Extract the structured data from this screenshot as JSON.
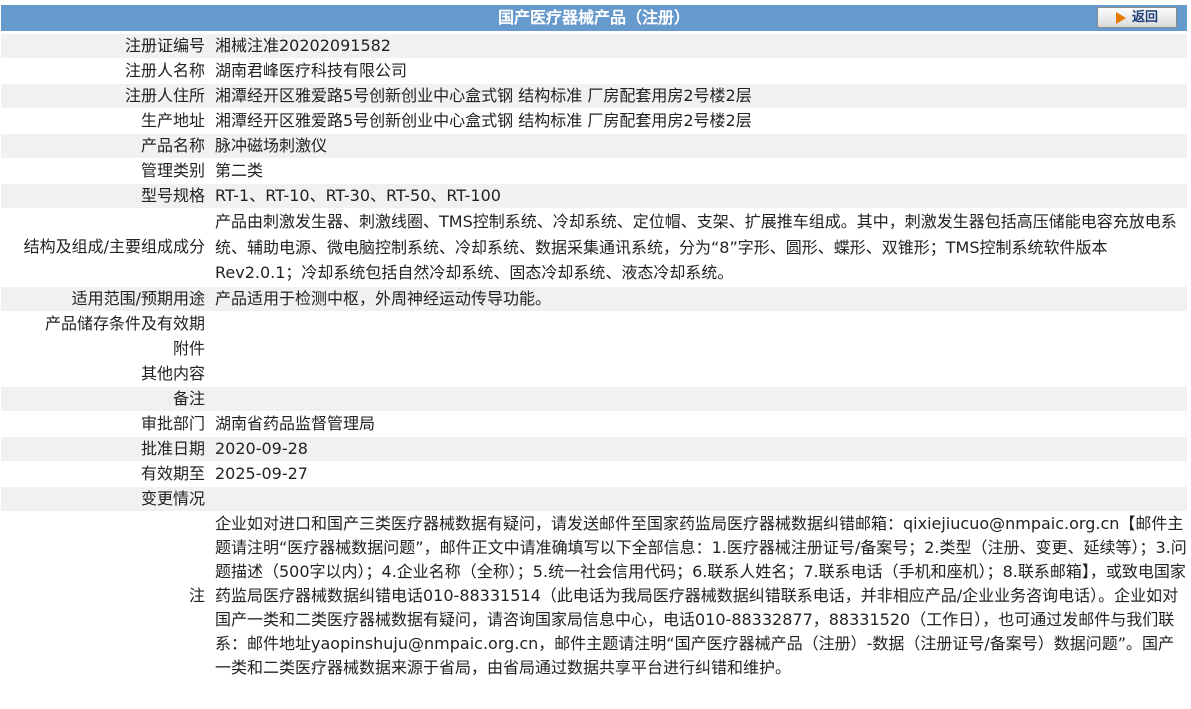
{
  "header": {
    "title": "国产医疗器械产品（注册）",
    "back_label": "返回"
  },
  "rows": [
    {
      "label": "注册证编号",
      "value": "湘械注准20202091582"
    },
    {
      "label": "注册人名称",
      "value": "湖南君峰医疗科技有限公司"
    },
    {
      "label": "注册人住所",
      "value": "湘潭经开区雅爱路5号创新创业中心盒式钢 结构标准 厂房配套用房2号楼2层"
    },
    {
      "label": "生产地址",
      "value": "湘潭经开区雅爱路5号创新创业中心盒式钢 结构标准 厂房配套用房2号楼2层"
    },
    {
      "label": "产品名称",
      "value": "脉冲磁场刺激仪"
    },
    {
      "label": "管理类别",
      "value": "第二类"
    },
    {
      "label": "型号规格",
      "value": "RT-1、RT-10、RT-30、RT-50、RT-100"
    },
    {
      "label": "结构及组成/主要组成成分",
      "value": "产品由刺激发生器、刺激线圈、TMS控制系统、冷却系统、定位帽、支架、扩展推车组成。其中，刺激发生器包括高压储能电容充放电系统、辅助电源、微电脑控制系统、冷却系统、数据采集通讯系统，分为“8”字形、圆形、蝶形、双锥形；TMS控制系统软件版本Rev2.0.1；冷却系统包括自然冷却系统、固态冷却系统、液态冷却系统。"
    },
    {
      "label": "适用范围/预期用途",
      "value": "产品适用于检测中枢，外周神经运动传导功能。"
    },
    {
      "label": "产品储存条件及有效期",
      "value": ""
    },
    {
      "label": "附件",
      "value": ""
    },
    {
      "label": "其他内容",
      "value": ""
    },
    {
      "label": "备注",
      "value": ""
    },
    {
      "label": "审批部门",
      "value": "湖南省药品监督管理局"
    },
    {
      "label": "批准日期",
      "value": "2020-09-28"
    },
    {
      "label": "有效期至",
      "value": "2025-09-27"
    },
    {
      "label": "变更情况",
      "value": ""
    }
  ],
  "note": {
    "label": "注",
    "text": "企业如对进口和国产三类医疗器械数据有疑问，请发送邮件至国家药监局医疗器械数据纠错邮箱：qixiejiucuo@nmpaic.org.cn【邮件主题请注明“医疗器械数据问题”，邮件正文中请准确填写以下全部信息：1.医疗器械注册证号/备案号；2.类型（注册、变更、延续等）；3.问题描述（500字以内）；4.企业名称（全称）；5.统一社会信用代码；6.联系人姓名；7.联系电话（手机和座机）；8.联系邮箱】，或致电国家药监局医疗器械数据纠错电话010-88331514（此电话为我局医疗器械数据纠错联系电话，并非相应产品/企业业务咨询电话）。企业如对国产一类和二类医疗器械数据有疑问，请咨询国家局信息中心，电话010-88332877，88331520（工作日），也可通过发邮件与我们联系：邮件地址yaopinshuju@nmpaic.org.cn，邮件主题请注明“国产医疗器械产品（注册）-数据（注册证号/备案号）数据问题”。国产一类和二类医疗器械数据来源于省局，由省局通过数据共享平台进行纠错和维护。"
  },
  "colors": {
    "header_bg": "#6699cc",
    "row_alt_bg": "#f1f1f1",
    "back_arrow": "#e67a00"
  }
}
